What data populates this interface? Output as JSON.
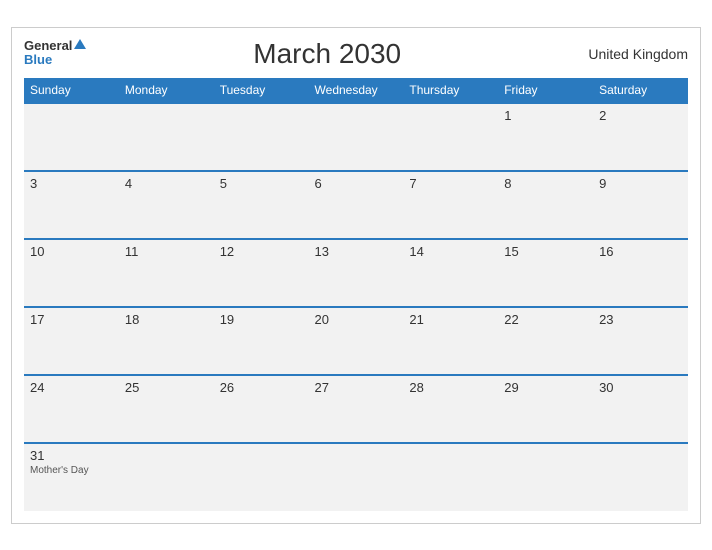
{
  "header": {
    "logo_general": "General",
    "logo_blue": "Blue",
    "title": "March 2030",
    "region": "United Kingdom"
  },
  "days_of_week": [
    "Sunday",
    "Monday",
    "Tuesday",
    "Wednesday",
    "Thursday",
    "Friday",
    "Saturday"
  ],
  "weeks": [
    [
      {
        "day": "",
        "event": ""
      },
      {
        "day": "",
        "event": ""
      },
      {
        "day": "",
        "event": ""
      },
      {
        "day": "",
        "event": ""
      },
      {
        "day": "",
        "event": ""
      },
      {
        "day": "1",
        "event": ""
      },
      {
        "day": "2",
        "event": ""
      }
    ],
    [
      {
        "day": "3",
        "event": ""
      },
      {
        "day": "4",
        "event": ""
      },
      {
        "day": "5",
        "event": ""
      },
      {
        "day": "6",
        "event": ""
      },
      {
        "day": "7",
        "event": ""
      },
      {
        "day": "8",
        "event": ""
      },
      {
        "day": "9",
        "event": ""
      }
    ],
    [
      {
        "day": "10",
        "event": ""
      },
      {
        "day": "11",
        "event": ""
      },
      {
        "day": "12",
        "event": ""
      },
      {
        "day": "13",
        "event": ""
      },
      {
        "day": "14",
        "event": ""
      },
      {
        "day": "15",
        "event": ""
      },
      {
        "day": "16",
        "event": ""
      }
    ],
    [
      {
        "day": "17",
        "event": ""
      },
      {
        "day": "18",
        "event": ""
      },
      {
        "day": "19",
        "event": ""
      },
      {
        "day": "20",
        "event": ""
      },
      {
        "day": "21",
        "event": ""
      },
      {
        "day": "22",
        "event": ""
      },
      {
        "day": "23",
        "event": ""
      }
    ],
    [
      {
        "day": "24",
        "event": ""
      },
      {
        "day": "25",
        "event": ""
      },
      {
        "day": "26",
        "event": ""
      },
      {
        "day": "27",
        "event": ""
      },
      {
        "day": "28",
        "event": ""
      },
      {
        "day": "29",
        "event": ""
      },
      {
        "day": "30",
        "event": ""
      }
    ],
    [
      {
        "day": "31",
        "event": "Mother's Day"
      },
      {
        "day": "",
        "event": ""
      },
      {
        "day": "",
        "event": ""
      },
      {
        "day": "",
        "event": ""
      },
      {
        "day": "",
        "event": ""
      },
      {
        "day": "",
        "event": ""
      },
      {
        "day": "",
        "event": ""
      }
    ]
  ],
  "colors": {
    "header_bg": "#2a7abf",
    "cell_bg": "#f2f2f2",
    "border": "#2a7abf"
  }
}
